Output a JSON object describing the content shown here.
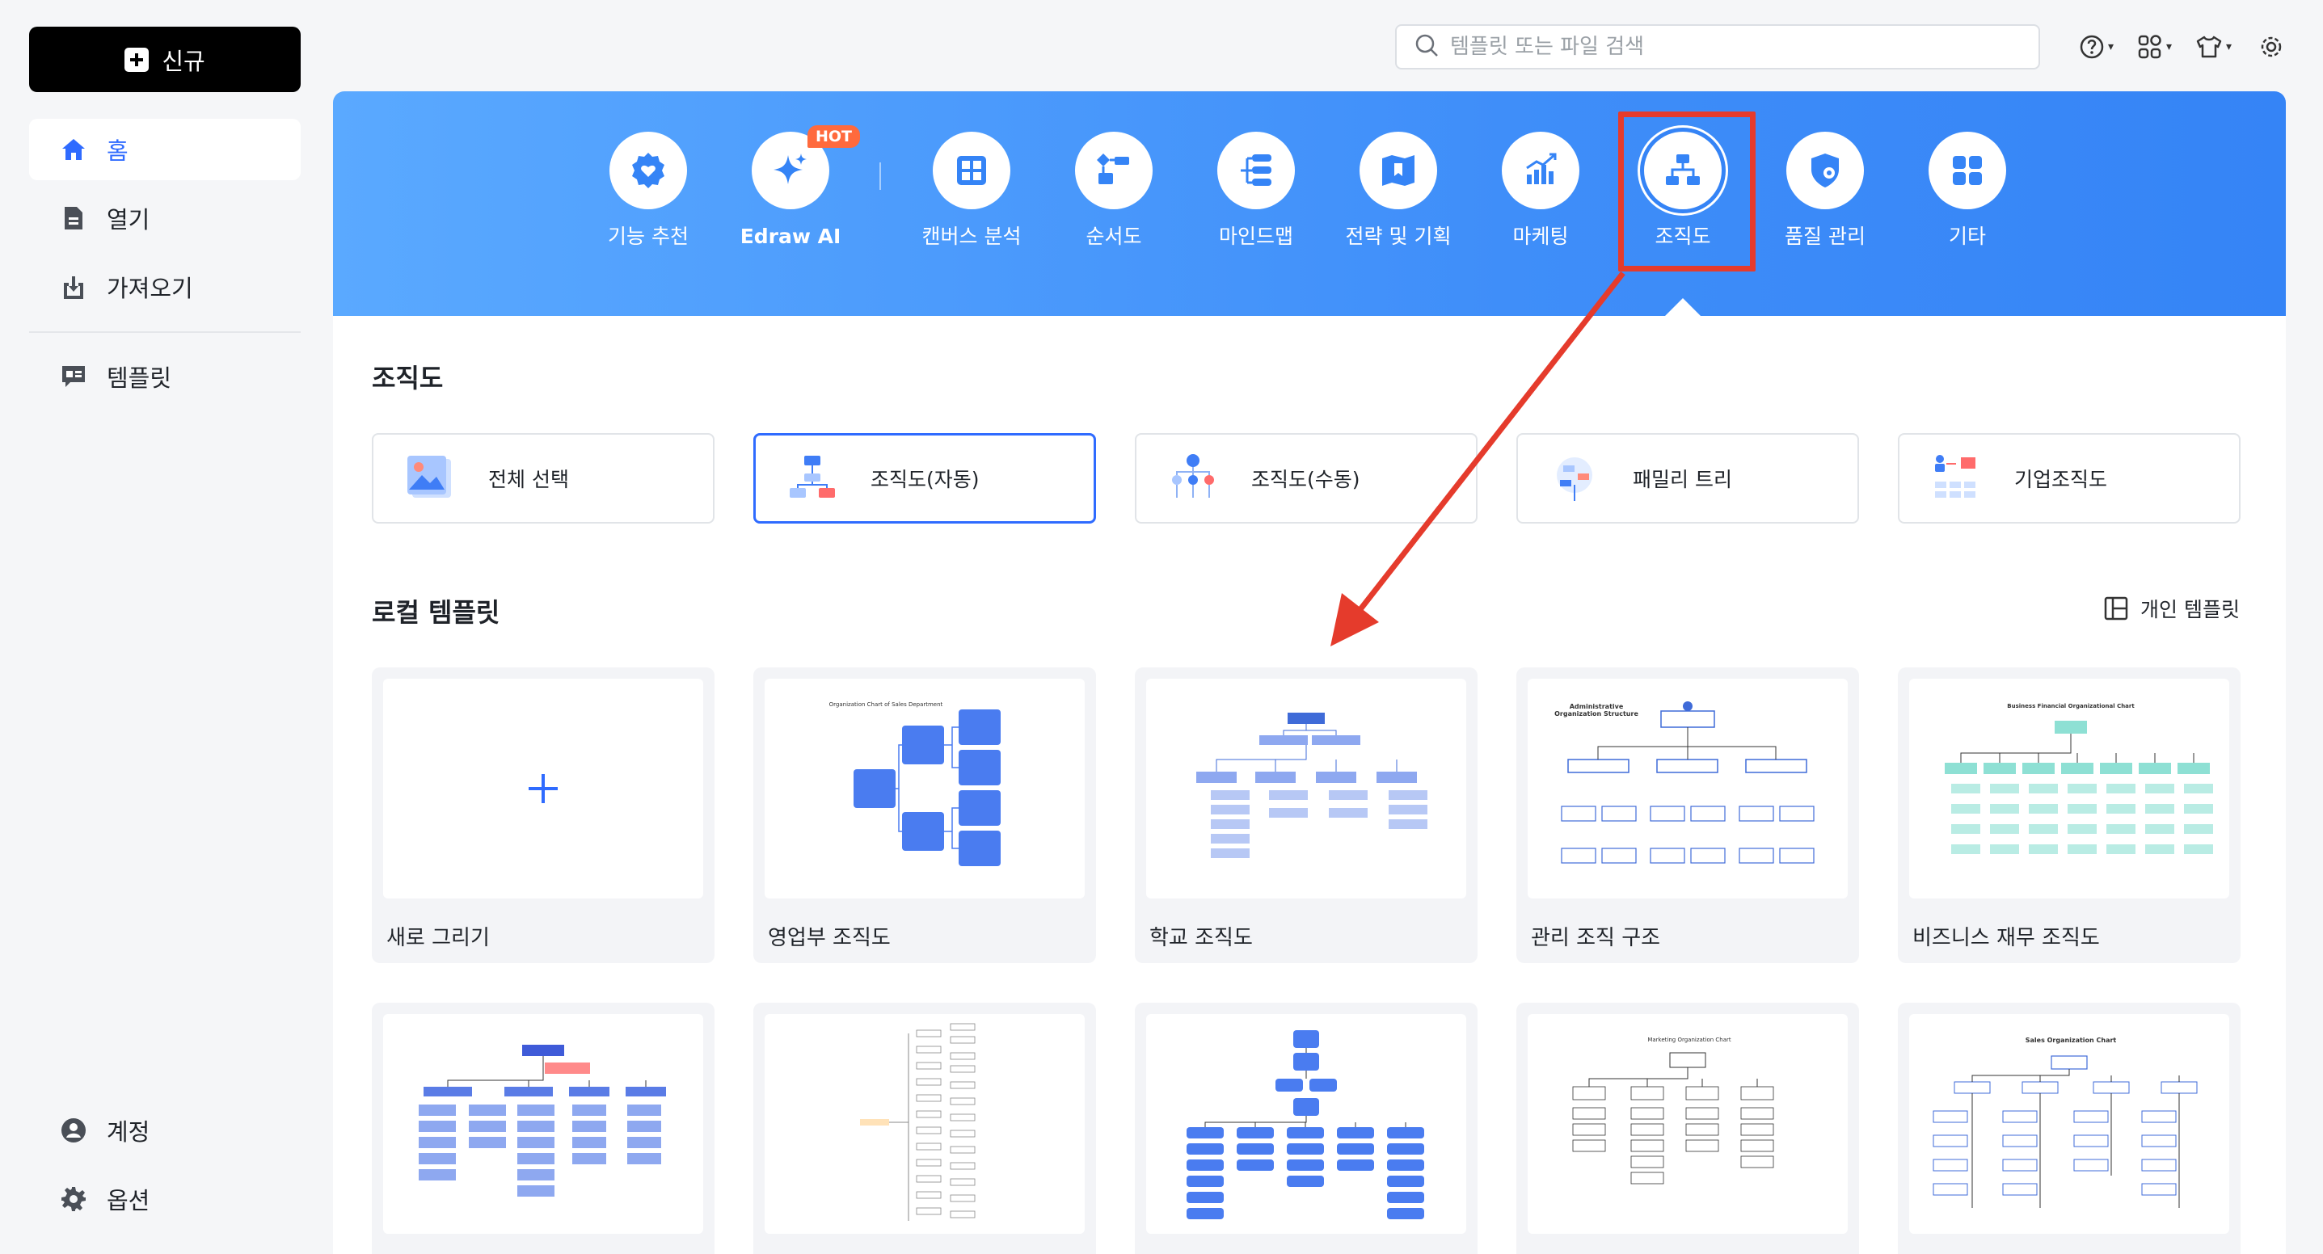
{
  "sidebar": {
    "new_label": "신규",
    "items": [
      {
        "label": "홈"
      },
      {
        "label": "열기"
      },
      {
        "label": "가져오기"
      },
      {
        "label": "템플릿"
      }
    ],
    "bottom": [
      {
        "label": "계정"
      },
      {
        "label": "옵션"
      }
    ]
  },
  "search": {
    "placeholder": "템플릿 또는 파일 검색"
  },
  "categories": [
    {
      "label": "기능 추천",
      "icon": "verified-heart-icon"
    },
    {
      "label": "Edraw AI",
      "icon": "sparkle-icon",
      "badge": "HOT"
    },
    {
      "label": "캔버스 분석",
      "icon": "canvas-grid-icon"
    },
    {
      "label": "순서도",
      "icon": "flowchart-icon"
    },
    {
      "label": "마인드맵",
      "icon": "mindmap-icon"
    },
    {
      "label": "전략 및 기획",
      "icon": "map-icon"
    },
    {
      "label": "마케팅",
      "icon": "bar-chart-icon"
    },
    {
      "label": "조직도",
      "icon": "org-chart-icon",
      "selected": true
    },
    {
      "label": "품질 관리",
      "icon": "shield-icon"
    },
    {
      "label": "기타",
      "icon": "apps-icon"
    }
  ],
  "section": {
    "title": "조직도",
    "subcategories": [
      {
        "label": "전체 선택"
      },
      {
        "label": "조직도(자동)",
        "selected": true
      },
      {
        "label": "조직도(수동)"
      },
      {
        "label": "패밀리 트리"
      },
      {
        "label": "기업조직도"
      }
    ]
  },
  "local": {
    "title": "로컬 템플릿",
    "personal_label": "개인 템플릿",
    "templates": [
      {
        "name": "새로 그리기"
      },
      {
        "name": "영업부 조직도",
        "preview_title": "Organization Chart of Sales Department"
      },
      {
        "name": "학교 조직도"
      },
      {
        "name": "관리 조직 구조",
        "preview_title": "Administrative Organization Structure"
      },
      {
        "name": "비즈니스 재무 조직도",
        "preview_title": "Business Financial Organizational Chart"
      }
    ],
    "row2_titles": [
      "Marketing Organization Chart",
      "Sales Organization Chart"
    ]
  },
  "colors": {
    "accent": "#2f6bff",
    "banner": "#3f8ef9",
    "highlight": "#e53b2c",
    "hot": "#ff6a3d"
  }
}
